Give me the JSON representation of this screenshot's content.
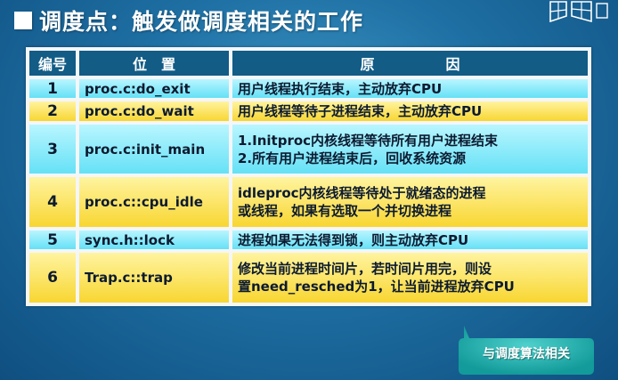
{
  "title": "调度点：触发做调度相关的工作",
  "table": {
    "headers": [
      "编号",
      "位　置",
      "原　　　　　因"
    ],
    "rows": [
      {
        "num": "1",
        "location": "proc.c:do_exit",
        "reason_lines": [
          "用户线程执行结束，主动放弃CPU"
        ],
        "style": "cyan"
      },
      {
        "num": "2",
        "location": "proc.c:do_wait",
        "reason_lines": [
          "用户线程等待子进程结束，主动放弃CPU"
        ],
        "style": "yellow"
      },
      {
        "num": "3",
        "location": "proc.c:init_main",
        "reason_lines": [
          "1.Initproc内核线程等待所有用户进程结束",
          "2.所有用户进程结束后，回收系统资源"
        ],
        "style": "cyan"
      },
      {
        "num": "4",
        "location": "proc.c::cpu_idle",
        "reason_lines": [
          "idleproc内核线程等待处于就绪态的进程",
          "或线程，如果有选取一个并切换进程"
        ],
        "style": "yellow"
      },
      {
        "num": "5",
        "location": "sync.h::lock",
        "reason_lines": [
          "进程如果无法得到锁，则主动放弃CPU"
        ],
        "style": "cyan"
      },
      {
        "num": "6",
        "location": "Trap.c::trap",
        "reason_lines": [
          "修改当前进程时间片，若时间片用完，则设",
          "置need_resched为1，让当前进程放弃CPU"
        ],
        "style": "yellow"
      }
    ]
  },
  "callout": {
    "text": "与调度算法相关"
  }
}
